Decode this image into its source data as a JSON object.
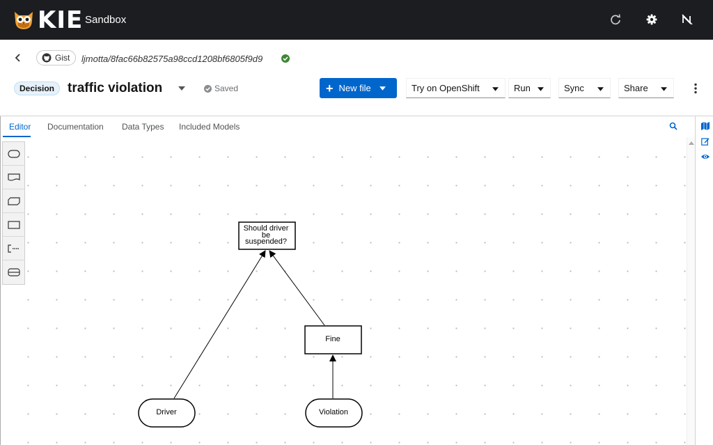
{
  "app": {
    "brand": "KIE",
    "product": "Sandbox"
  },
  "gist": {
    "chip_label": "Gist",
    "path": "ljmotta/8fac66b82575a98ccd1208bf6805f9d9"
  },
  "file": {
    "type_badge": "Decision",
    "name": "traffic violation",
    "save_status": "Saved"
  },
  "toolbar": {
    "new_file": "New file",
    "try_openshift": "Try on OpenShift",
    "run": "Run",
    "sync": "Sync",
    "share": "Share"
  },
  "tabs": [
    {
      "label": "Editor",
      "active": true
    },
    {
      "label": "Documentation",
      "active": false
    },
    {
      "label": "Data Types",
      "active": false
    },
    {
      "label": "Included Models",
      "active": false
    }
  ],
  "palette": [
    "input-data-icon",
    "knowledge-source-icon",
    "business-knowledge-model-icon",
    "decision-icon",
    "text-annotation-icon",
    "decision-service-icon"
  ],
  "diagram": {
    "decision": "Should driver be suspended?",
    "decision_lines": [
      "Should driver",
      "be",
      "suspended?"
    ],
    "fine": "Fine",
    "driver": "Driver",
    "violation": "Violation"
  },
  "colors": {
    "topbar": "#1b1d21",
    "primary": "#0066cc",
    "saved_check": "#3e8635"
  }
}
